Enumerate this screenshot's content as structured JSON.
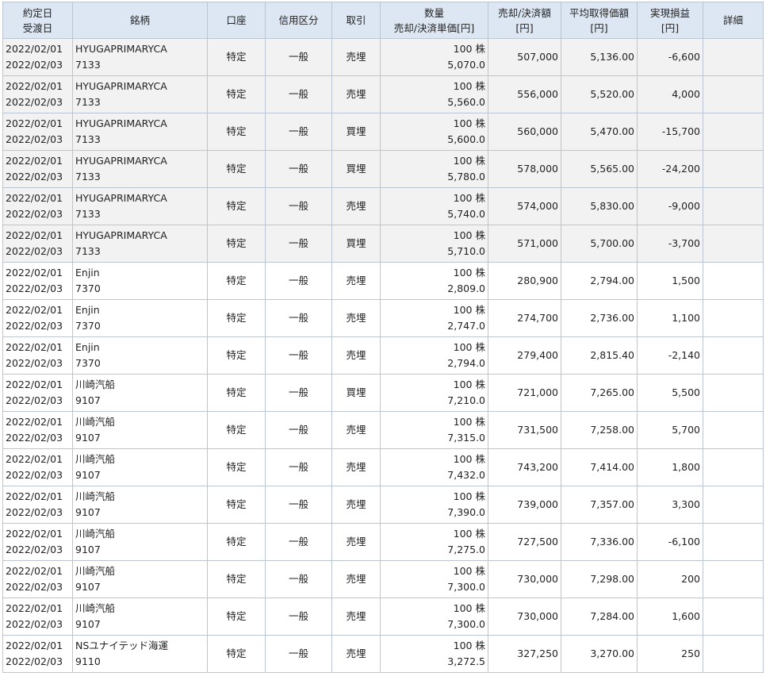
{
  "table": {
    "headers": {
      "date": [
        "約定日",
        "受渡日"
      ],
      "name": [
        "銘柄"
      ],
      "account": [
        "口座"
      ],
      "credit": [
        "信用区分"
      ],
      "trade": [
        "取引"
      ],
      "quantity": [
        "数量",
        "売却/決済単価[円]"
      ],
      "amount": [
        "売却/決済額",
        "[円]"
      ],
      "avg_cost": [
        "平均取得価額",
        "[円]"
      ],
      "pnl": [
        "実現損益",
        "[円]"
      ],
      "detail": [
        "詳細"
      ]
    },
    "rows": [
      {
        "trade_date": "2022/02/01",
        "settle_date": "2022/02/03",
        "name": "HYUGAPRIMARYCA",
        "code": "7133",
        "account": "特定",
        "credit": "一般",
        "trade": "売埋",
        "quantity": "100 株",
        "price": "5,070.0",
        "amount": "507,000",
        "avg_cost": "5,136.00",
        "pnl": "-6,600",
        "shaded": true
      },
      {
        "trade_date": "2022/02/01",
        "settle_date": "2022/02/03",
        "name": "HYUGAPRIMARYCA",
        "code": "7133",
        "account": "特定",
        "credit": "一般",
        "trade": "売埋",
        "quantity": "100 株",
        "price": "5,560.0",
        "amount": "556,000",
        "avg_cost": "5,520.00",
        "pnl": "4,000",
        "shaded": true
      },
      {
        "trade_date": "2022/02/01",
        "settle_date": "2022/02/03",
        "name": "HYUGAPRIMARYCA",
        "code": "7133",
        "account": "特定",
        "credit": "一般",
        "trade": "買埋",
        "quantity": "100 株",
        "price": "5,600.0",
        "amount": "560,000",
        "avg_cost": "5,470.00",
        "pnl": "-15,700",
        "shaded": true
      },
      {
        "trade_date": "2022/02/01",
        "settle_date": "2022/02/03",
        "name": "HYUGAPRIMARYCA",
        "code": "7133",
        "account": "特定",
        "credit": "一般",
        "trade": "買埋",
        "quantity": "100 株",
        "price": "5,780.0",
        "amount": "578,000",
        "avg_cost": "5,565.00",
        "pnl": "-24,200",
        "shaded": true
      },
      {
        "trade_date": "2022/02/01",
        "settle_date": "2022/02/03",
        "name": "HYUGAPRIMARYCA",
        "code": "7133",
        "account": "特定",
        "credit": "一般",
        "trade": "売埋",
        "quantity": "100 株",
        "price": "5,740.0",
        "amount": "574,000",
        "avg_cost": "5,830.00",
        "pnl": "-9,000",
        "shaded": true
      },
      {
        "trade_date": "2022/02/01",
        "settle_date": "2022/02/03",
        "name": "HYUGAPRIMARYCA",
        "code": "7133",
        "account": "特定",
        "credit": "一般",
        "trade": "買埋",
        "quantity": "100 株",
        "price": "5,710.0",
        "amount": "571,000",
        "avg_cost": "5,700.00",
        "pnl": "-3,700",
        "shaded": true
      },
      {
        "trade_date": "2022/02/01",
        "settle_date": "2022/02/03",
        "name": "Enjin",
        "code": "7370",
        "account": "特定",
        "credit": "一般",
        "trade": "売埋",
        "quantity": "100 株",
        "price": "2,809.0",
        "amount": "280,900",
        "avg_cost": "2,794.00",
        "pnl": "1,500",
        "shaded": false
      },
      {
        "trade_date": "2022/02/01",
        "settle_date": "2022/02/03",
        "name": "Enjin",
        "code": "7370",
        "account": "特定",
        "credit": "一般",
        "trade": "売埋",
        "quantity": "100 株",
        "price": "2,747.0",
        "amount": "274,700",
        "avg_cost": "2,736.00",
        "pnl": "1,100",
        "shaded": false
      },
      {
        "trade_date": "2022/02/01",
        "settle_date": "2022/02/03",
        "name": "Enjin",
        "code": "7370",
        "account": "特定",
        "credit": "一般",
        "trade": "売埋",
        "quantity": "100 株",
        "price": "2,794.0",
        "amount": "279,400",
        "avg_cost": "2,815.40",
        "pnl": "-2,140",
        "shaded": false
      },
      {
        "trade_date": "2022/02/01",
        "settle_date": "2022/02/03",
        "name": "川崎汽船",
        "code": "9107",
        "account": "特定",
        "credit": "一般",
        "trade": "買埋",
        "quantity": "100 株",
        "price": "7,210.0",
        "amount": "721,000",
        "avg_cost": "7,265.00",
        "pnl": "5,500",
        "shaded": false
      },
      {
        "trade_date": "2022/02/01",
        "settle_date": "2022/02/03",
        "name": "川崎汽船",
        "code": "9107",
        "account": "特定",
        "credit": "一般",
        "trade": "売埋",
        "quantity": "100 株",
        "price": "7,315.0",
        "amount": "731,500",
        "avg_cost": "7,258.00",
        "pnl": "5,700",
        "shaded": false
      },
      {
        "trade_date": "2022/02/01",
        "settle_date": "2022/02/03",
        "name": "川崎汽船",
        "code": "9107",
        "account": "特定",
        "credit": "一般",
        "trade": "売埋",
        "quantity": "100 株",
        "price": "7,432.0",
        "amount": "743,200",
        "avg_cost": "7,414.00",
        "pnl": "1,800",
        "shaded": false
      },
      {
        "trade_date": "2022/02/01",
        "settle_date": "2022/02/03",
        "name": "川崎汽船",
        "code": "9107",
        "account": "特定",
        "credit": "一般",
        "trade": "売埋",
        "quantity": "100 株",
        "price": "7,390.0",
        "amount": "739,000",
        "avg_cost": "7,357.00",
        "pnl": "3,300",
        "shaded": false
      },
      {
        "trade_date": "2022/02/01",
        "settle_date": "2022/02/03",
        "name": "川崎汽船",
        "code": "9107",
        "account": "特定",
        "credit": "一般",
        "trade": "売埋",
        "quantity": "100 株",
        "price": "7,275.0",
        "amount": "727,500",
        "avg_cost": "7,336.00",
        "pnl": "-6,100",
        "shaded": false
      },
      {
        "trade_date": "2022/02/01",
        "settle_date": "2022/02/03",
        "name": "川崎汽船",
        "code": "9107",
        "account": "特定",
        "credit": "一般",
        "trade": "売埋",
        "quantity": "100 株",
        "price": "7,300.0",
        "amount": "730,000",
        "avg_cost": "7,298.00",
        "pnl": "200",
        "shaded": false
      },
      {
        "trade_date": "2022/02/01",
        "settle_date": "2022/02/03",
        "name": "川崎汽船",
        "code": "9107",
        "account": "特定",
        "credit": "一般",
        "trade": "売埋",
        "quantity": "100 株",
        "price": "7,300.0",
        "amount": "730,000",
        "avg_cost": "7,284.00",
        "pnl": "1,600",
        "shaded": false
      },
      {
        "trade_date": "2022/02/01",
        "settle_date": "2022/02/03",
        "name": "NSユナイテッド海運",
        "code": "9110",
        "account": "特定",
        "credit": "一般",
        "trade": "売埋",
        "quantity": "100 株",
        "price": "3,272.5",
        "amount": "327,250",
        "avg_cost": "3,270.00",
        "pnl": "250",
        "shaded": false
      }
    ]
  },
  "colors": {
    "header_bg": "#dde7f3",
    "shaded_row_bg": "#f2f2f2",
    "border": "#bcc6d2"
  }
}
